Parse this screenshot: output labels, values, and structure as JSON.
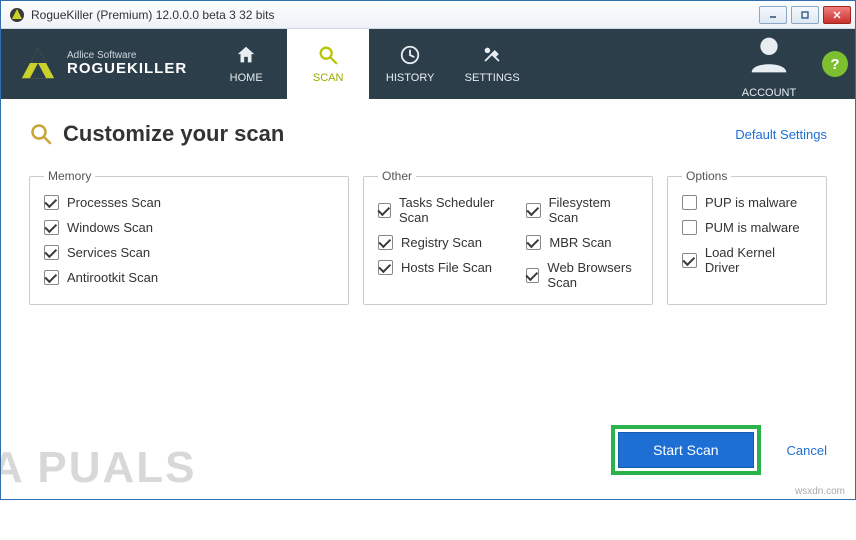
{
  "window": {
    "title": "RogueKiller (Premium) 12.0.0.0 beta 3 32 bits"
  },
  "brand": {
    "line1": "Adlice Software",
    "line2": "ROGUEKILLER"
  },
  "nav": {
    "home": "HOME",
    "scan": "SCAN",
    "history": "HISTORY",
    "settings": "SETTINGS",
    "account": "ACCOUNT",
    "help": "?"
  },
  "page": {
    "title": "Customize your scan",
    "default_link": "Default Settings"
  },
  "groups": {
    "memory": {
      "legend": "Memory",
      "items": [
        "Processes Scan",
        "Windows Scan",
        "Services Scan",
        "Antirootkit Scan"
      ],
      "checked": [
        true,
        true,
        true,
        true
      ]
    },
    "other": {
      "legend": "Other",
      "col1": [
        "Tasks Scheduler Scan",
        "Registry Scan",
        "Hosts File Scan"
      ],
      "col1_checked": [
        true,
        true,
        true
      ],
      "col2": [
        "Filesystem Scan",
        "MBR Scan",
        "Web Browsers Scan"
      ],
      "col2_checked": [
        true,
        true,
        true
      ]
    },
    "options": {
      "legend": "Options",
      "items": [
        "PUP is malware",
        "PUM is malware",
        "Load Kernel Driver"
      ],
      "checked": [
        false,
        false,
        true
      ]
    }
  },
  "footer": {
    "start": "Start Scan",
    "cancel": "Cancel"
  },
  "watermark": "A PUALS",
  "watermark2": "wsxdn.com"
}
